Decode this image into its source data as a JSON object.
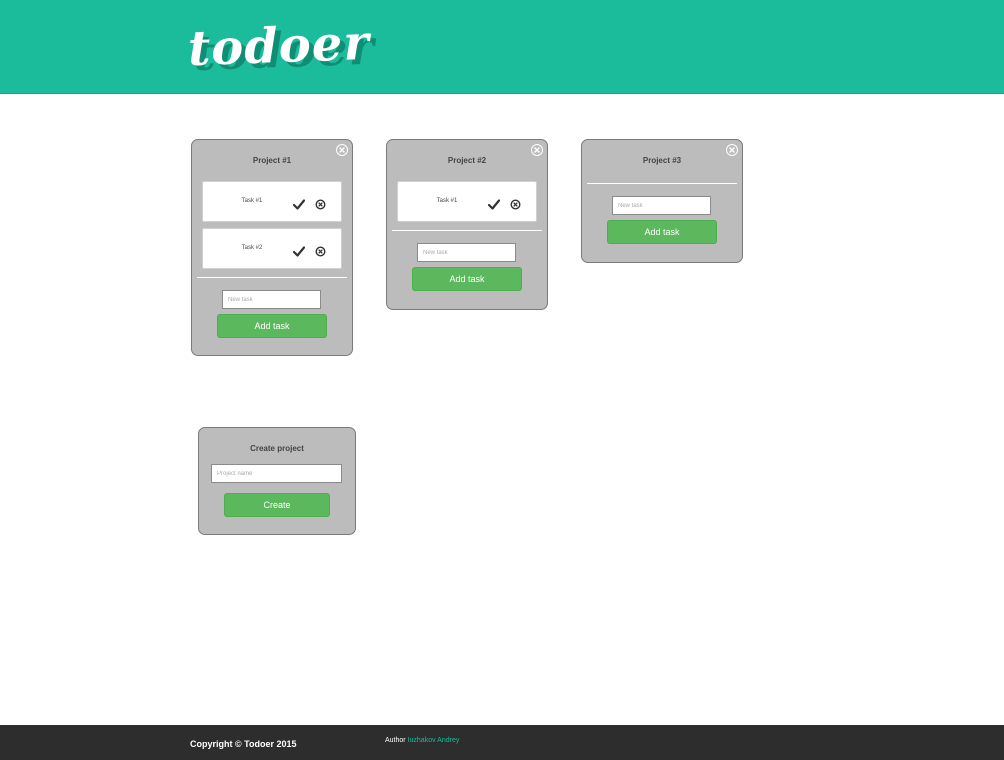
{
  "app": {
    "logo_text": "todoer",
    "accent_color": "#1abc9c",
    "button_color": "#5cb85c"
  },
  "projects": [
    {
      "title": "Project #1",
      "tasks": [
        {
          "label": "Task #1"
        },
        {
          "label": "Task #2"
        }
      ],
      "new_task_placeholder": "New task",
      "add_button": "Add task"
    },
    {
      "title": "Project #2",
      "tasks": [
        {
          "label": "Task #1"
        }
      ],
      "new_task_placeholder": "New task",
      "add_button": "Add task"
    },
    {
      "title": "Project #3",
      "tasks": [],
      "new_task_placeholder": "New task",
      "add_button": "Add task"
    }
  ],
  "create_project": {
    "title": "Create project",
    "name_placeholder": "Project name",
    "button": "Create"
  },
  "footer": {
    "copyright": "Copyright © Todoer 2015",
    "author_label": "Author",
    "author_name": "Iuzhakov Andrey"
  },
  "icons": {
    "close": "close-circle-icon",
    "check": "checkmark-icon",
    "delete": "delete-circle-icon"
  }
}
